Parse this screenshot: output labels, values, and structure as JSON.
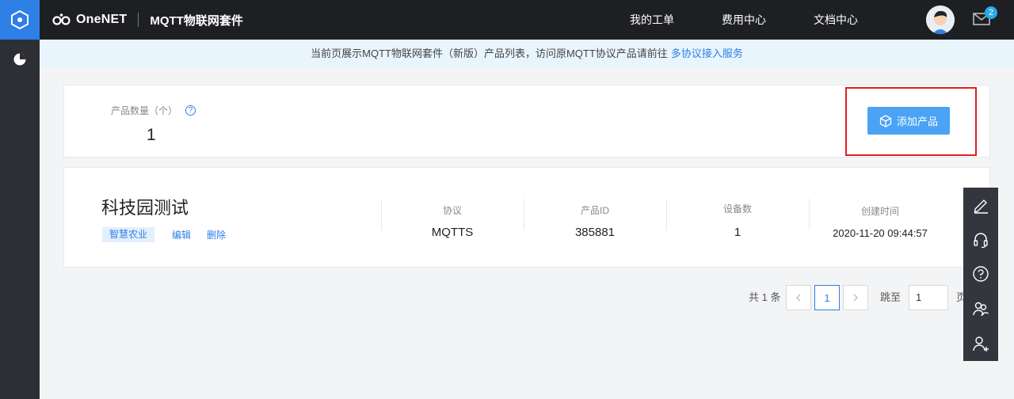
{
  "header": {
    "logo_text": "OneNET",
    "suite_title": "MQTT物联网套件",
    "nav": [
      {
        "label": "我的工单"
      },
      {
        "label": "费用中心"
      },
      {
        "label": "文档中心"
      }
    ],
    "mail_badge": "2"
  },
  "notice": {
    "text": "当前页展示MQTT物联网套件（新版）产品列表，访问原MQTT协议产品请前往",
    "link": "多协议接入服务"
  },
  "stats": {
    "label": "产品数量（个）",
    "help": "?",
    "value": "1",
    "add_button": "添加产品"
  },
  "product": {
    "name": "科技园测试",
    "tag": "智慧农业",
    "actions": {
      "edit": "编辑",
      "delete": "删除"
    },
    "columns": [
      {
        "label": "协议",
        "value": "MQTTS"
      },
      {
        "label": "产品ID",
        "value": "385881"
      },
      {
        "label": "设备数",
        "value": "1"
      },
      {
        "label": "创建时间",
        "value": "2020-11-20 09:44:57"
      }
    ]
  },
  "pagination": {
    "total": "共 1 条",
    "current_page": "1",
    "jump_label": "跳至",
    "jump_value": "1",
    "page_suffix": "页"
  },
  "colors": {
    "accent": "#2e7fe6",
    "topbar": "#1e1f22",
    "highlight": "#e02020"
  }
}
